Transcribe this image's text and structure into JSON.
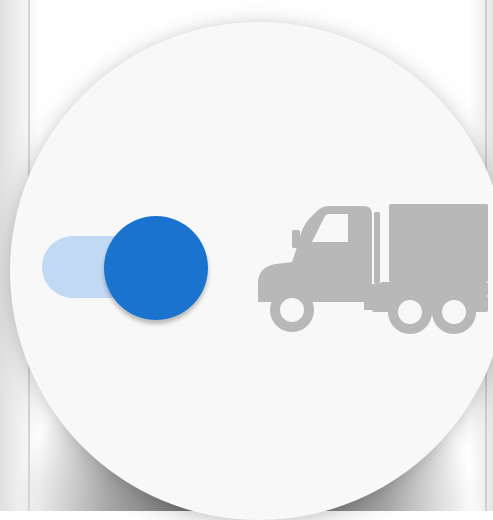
{
  "toggle": {
    "state": "on",
    "accent_color": "#1a73cf",
    "track_color": "#c2d9f3"
  },
  "icons": {
    "truck": "truck-icon",
    "truck_color": "#b8b8b8"
  },
  "card": {
    "background": "#f8f8f8"
  }
}
